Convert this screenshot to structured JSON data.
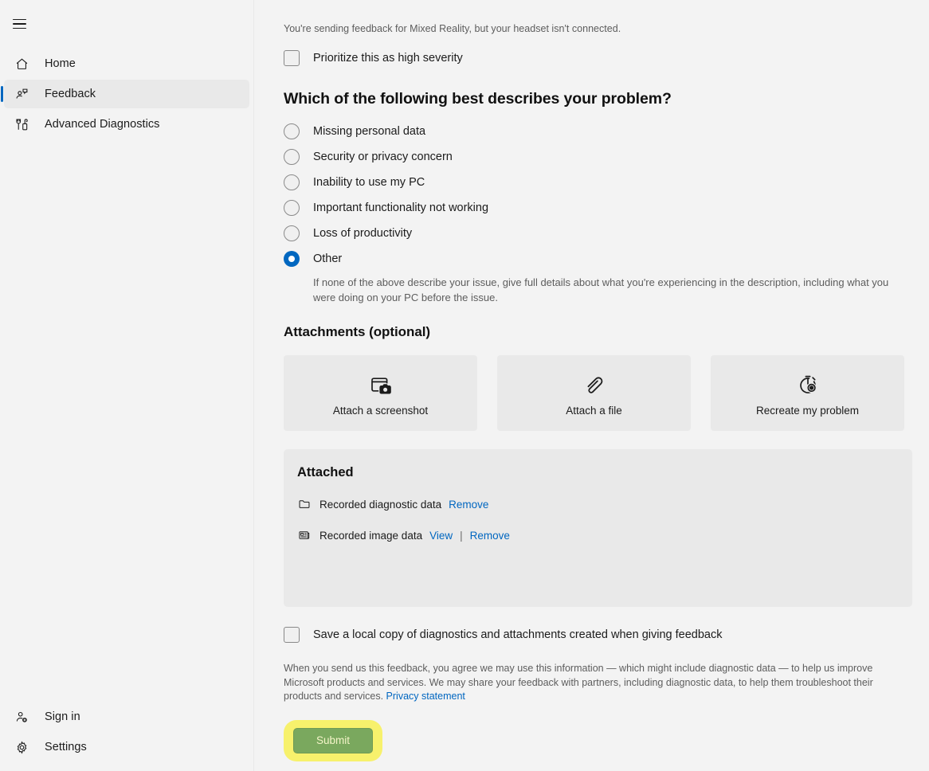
{
  "sidebar": {
    "menu_icon": "hamburger-icon",
    "top_items": [
      {
        "label": "Home",
        "icon": "home-icon",
        "active": false
      },
      {
        "label": "Feedback",
        "icon": "feedback-icon",
        "active": true
      },
      {
        "label": "Advanced Diagnostics",
        "icon": "diagnostics-icon",
        "active": false
      }
    ],
    "bottom_items": [
      {
        "label": "Sign in",
        "icon": "person-add-icon"
      },
      {
        "label": "Settings",
        "icon": "gear-icon"
      }
    ]
  },
  "main": {
    "notice": "You're sending feedback for Mixed Reality, but your headset isn't connected.",
    "prioritize": {
      "label": "Prioritize this as high severity",
      "checked": false
    },
    "problem_question": "Which of the following best describes your problem?",
    "problem_options": [
      {
        "label": "Missing personal data",
        "selected": false
      },
      {
        "label": "Security or privacy concern",
        "selected": false
      },
      {
        "label": "Inability to use my PC",
        "selected": false
      },
      {
        "label": "Important functionality not working",
        "selected": false
      },
      {
        "label": "Loss of productivity",
        "selected": false
      },
      {
        "label": "Other",
        "selected": true
      }
    ],
    "other_help": "If none of the above describe your issue, give full details about what you're experiencing in the description, including what you were doing on your PC before the issue.",
    "attachments_title": "Attachments (optional)",
    "attachment_buttons": [
      {
        "label": "Attach a screenshot",
        "icon": "screenshot-camera-icon"
      },
      {
        "label": "Attach a file",
        "icon": "paperclip-icon"
      },
      {
        "label": "Recreate my problem",
        "icon": "stopwatch-record-icon"
      }
    ],
    "attached": {
      "title": "Attached",
      "items": [
        {
          "name": "Recorded diagnostic data",
          "icon": "folder-icon",
          "actions": [
            "Remove"
          ]
        },
        {
          "name": "Recorded image data",
          "icon": "image-data-icon",
          "actions": [
            "View",
            "Remove"
          ]
        }
      ],
      "separator": "|"
    },
    "save_local": {
      "label": "Save a local copy of diagnostics and attachments created when giving feedback",
      "checked": false
    },
    "legal_text": "When you send us this feedback, you agree we may use this information — which might include diagnostic data — to help us improve Microsoft products and services. We may share your feedback with partners, including diagnostic data, to help them troubleshoot their products and services. ",
    "privacy_link": "Privacy statement",
    "submit_label": "Submit"
  },
  "colors": {
    "accent": "#0067c0",
    "link": "#0066c0",
    "page_bg": "#f3f3f3",
    "panel_bg": "#e9e9e9",
    "submit_bg": "#7aa85e",
    "highlight": "#f7f16c"
  }
}
